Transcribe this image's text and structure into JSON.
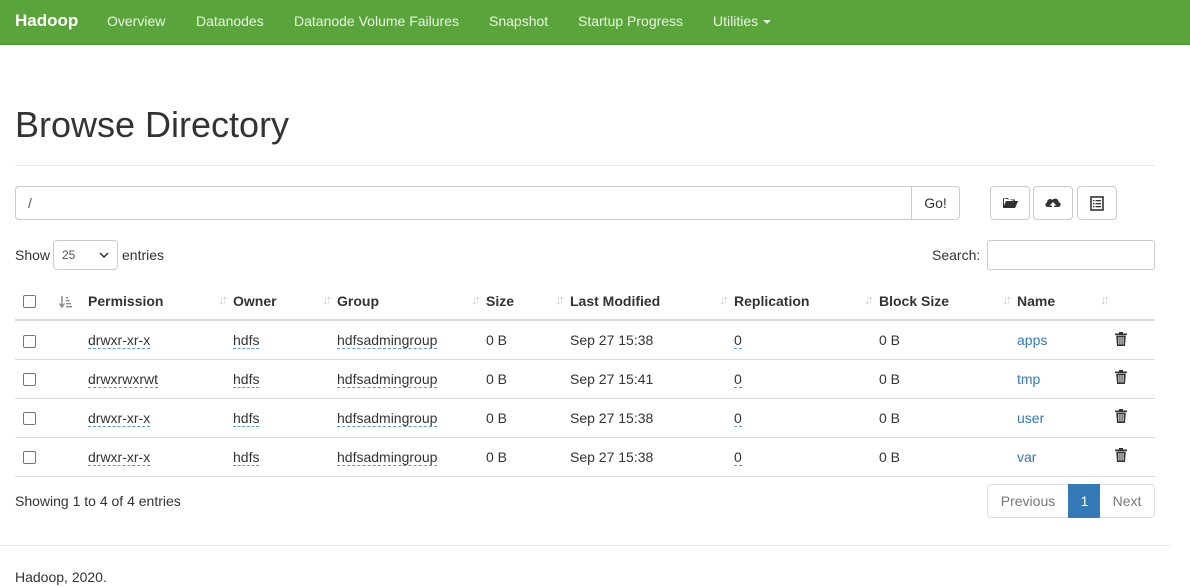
{
  "nav": {
    "brand": "Hadoop",
    "items": [
      "Overview",
      "Datanodes",
      "Datanode Volume Failures",
      "Snapshot",
      "Startup Progress",
      "Utilities"
    ]
  },
  "page": {
    "title": "Browse Directory"
  },
  "path": {
    "value": "/",
    "go_label": "Go!"
  },
  "toolbar": {
    "icons": [
      "folder-open-icon",
      "cloud-upload-icon",
      "list-alt-icon"
    ]
  },
  "table_controls": {
    "show_label": "Show",
    "entries_value": "25",
    "entries_label": "entries",
    "search_label": "Search:"
  },
  "table": {
    "headers": [
      "Permission",
      "Owner",
      "Group",
      "Size",
      "Last Modified",
      "Replication",
      "Block Size",
      "Name"
    ],
    "rows": [
      {
        "permission": "drwxr-xr-x",
        "owner": "hdfs",
        "group": "hdfsadmingroup",
        "size": "0 B",
        "modified": "Sep 27 15:38",
        "replication": "0",
        "block_size": "0 B",
        "name": "apps"
      },
      {
        "permission": "drwxrwxrwt",
        "owner": "hdfs",
        "group": "hdfsadmingroup",
        "size": "0 B",
        "modified": "Sep 27 15:41",
        "replication": "0",
        "block_size": "0 B",
        "name": "tmp"
      },
      {
        "permission": "drwxr-xr-x",
        "owner": "hdfs",
        "group": "hdfsadmingroup",
        "size": "0 B",
        "modified": "Sep 27 15:38",
        "replication": "0",
        "block_size": "0 B",
        "name": "user"
      },
      {
        "permission": "drwxr-xr-x",
        "owner": "hdfs",
        "group": "hdfsadmingroup",
        "size": "0 B",
        "modified": "Sep 27 15:38",
        "replication": "0",
        "block_size": "0 B",
        "name": "var"
      }
    ]
  },
  "info": {
    "text": "Showing 1 to 4 of 4 entries"
  },
  "pagination": {
    "previous": "Previous",
    "current": "1",
    "next": "Next"
  },
  "footer": {
    "text": "Hadoop, 2020."
  },
  "colors": {
    "navbar": "#5aa53b",
    "link": "#337ab7",
    "active_page": "#337ab7"
  }
}
